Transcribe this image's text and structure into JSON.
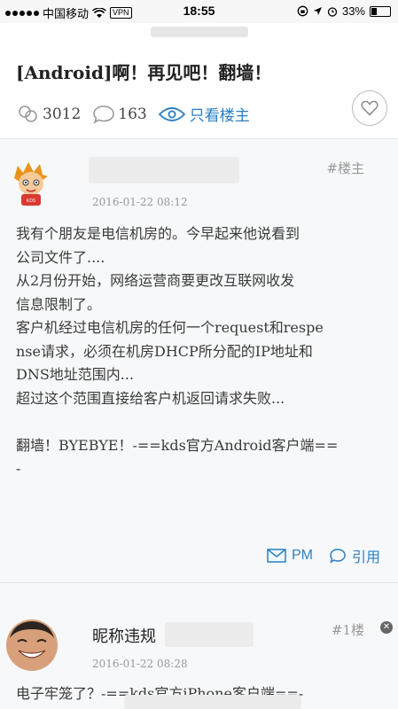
{
  "status_bar": {
    "carrier": "中国移动",
    "vpn": "VPN",
    "time": "18:55",
    "battery": "33%",
    "battery_level": 0.33
  },
  "thread": {
    "title": "[Android]啊！再见吧！翻墙！",
    "views": "3012",
    "replies": "163",
    "only_owner_label": "只看楼主"
  },
  "posts": [
    {
      "floor": "#楼主",
      "date": "2016-01-22 08:12",
      "lines": [
        "我有个朋友是电信机房的。今早起来他说看到",
        "公司文件了....",
        "从2月份开始，网络运营商要更改互联网收发",
        "信息限制了。",
        "客户机经过电信机房的任何一个request和respe",
        "nse请求，必须在机房DHCP所分配的IP地址和",
        "DNS地址范围内...",
        "超过这个范围直接给客户机返回请求失败...",
        "",
        "翻墙！BYEBYE！-==kds官方Android客户端==",
        "-"
      ],
      "pm_label": "PM",
      "quote_label": "引用"
    },
    {
      "nickname": "昵称违规",
      "floor": "#1楼",
      "date": "2016-01-22 08:28",
      "text": "电子牢笼了？-==kds官方iPhone客户端==-"
    }
  ],
  "colors": {
    "accent": "#2a7fc3",
    "post_bg": "#f7f8f9"
  }
}
